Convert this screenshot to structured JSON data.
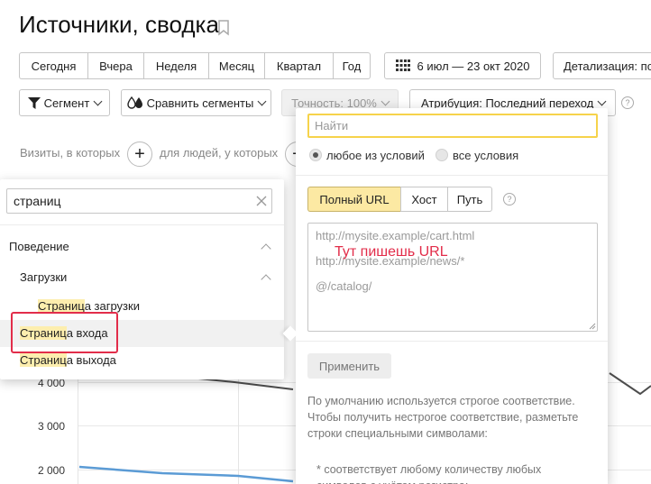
{
  "header": {
    "title": "Источники, сводка"
  },
  "periods": [
    "Сегодня",
    "Вчера",
    "Неделя",
    "Месяц",
    "Квартал",
    "Год"
  ],
  "date_range": "6 июл — 23 окт 2020",
  "detail": "Детализация: по",
  "toolbar": {
    "segment": "Сегмент",
    "compare": "Сравнить сегменты",
    "accuracy": "Точность: 100%",
    "attribution": "Атрибуция: Последний переход"
  },
  "filter_row": {
    "visits_label": "Визиты, в которых",
    "people_label": "для людей, у которых",
    "plus": "+"
  },
  "chart": {
    "y_labels": [
      "4 000",
      "3 000",
      "2 000"
    ],
    "colors": {
      "dark_line": "#4d4d4d",
      "blue_line": "#5b9bd5"
    }
  },
  "dropdown": {
    "search_value": "страниц",
    "group": "Поведение",
    "subgroup": "Загрузки",
    "items": [
      {
        "hl": "Страниц",
        "rest": "а загрузки"
      },
      {
        "hl": "Страниц",
        "rest": "а входа"
      },
      {
        "hl": "Страниц",
        "rest": "а выхода"
      }
    ]
  },
  "panel": {
    "find_placeholder": "Найти",
    "radio_any": "любое из условий",
    "radio_all": "все условия",
    "tabs": [
      "Полный URL",
      "Хост",
      "Путь"
    ],
    "help": "?",
    "url_examples": [
      "http://mysite.example/cart.html",
      "http://mysite.example/news/*",
      "@/catalog/"
    ],
    "url_note": "Тут пишешь URL",
    "apply": "Применить",
    "note_1": "По умолчанию используется строгое соответствие. Чтобы получить нестрогое соответствие, разметьте строки специальными символами:",
    "note_2": "* соответствует любому количеству любых символов с учётом регистра;"
  },
  "colors": {
    "accent_yellow": "#fce9a3",
    "highlight_red": "#e22d4a"
  }
}
